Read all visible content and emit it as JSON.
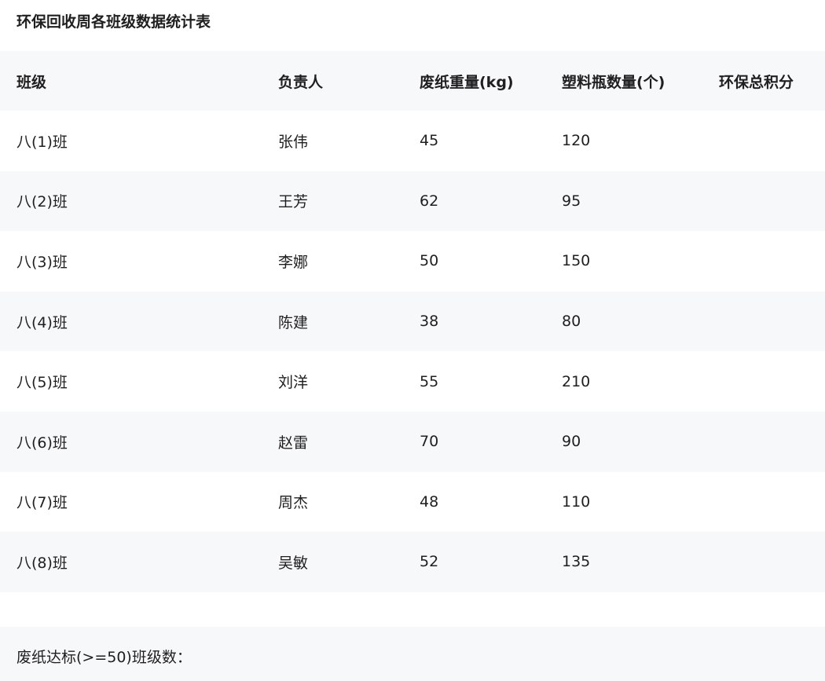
{
  "title": "环保回收周各班级数据统计表",
  "table": {
    "headers": [
      "班级",
      "负责人",
      "废纸重量(kg)",
      "塑料瓶数量(个)",
      "环保总积分"
    ],
    "rows": [
      [
        "八(1)班",
        "张伟",
        "45",
        "120",
        ""
      ],
      [
        "八(2)班",
        "王芳",
        "62",
        "95",
        ""
      ],
      [
        "八(3)班",
        "李娜",
        "50",
        "150",
        ""
      ],
      [
        "八(4)班",
        "陈建",
        "38",
        "80",
        ""
      ],
      [
        "八(5)班",
        "刘洋",
        "55",
        "210",
        ""
      ],
      [
        "八(6)班",
        "赵雷",
        "70",
        "90",
        ""
      ],
      [
        "八(7)班",
        "周杰",
        "48",
        "110",
        ""
      ],
      [
        "八(8)班",
        "吴敏",
        "52",
        "135",
        ""
      ]
    ]
  },
  "summary": {
    "label": "废纸达标(>=50)班级数："
  }
}
